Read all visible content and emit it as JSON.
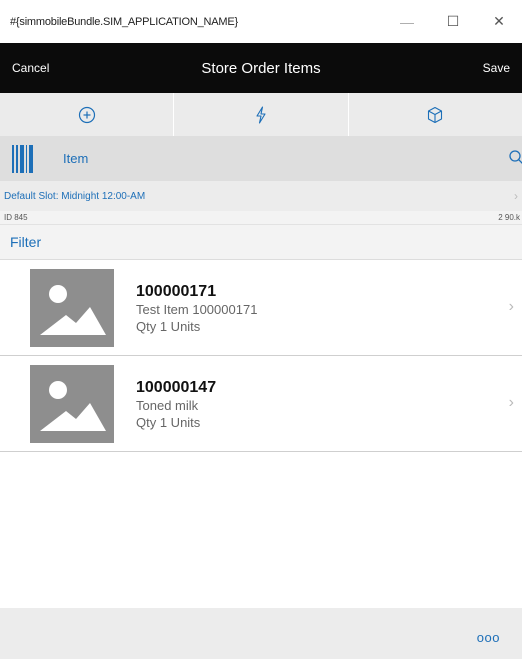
{
  "window": {
    "title": "#{simmobileBundle.SIM_APPLICATION_NAME}",
    "minimize_label": "—",
    "maximize_label": "☐",
    "close_label": "✕"
  },
  "header": {
    "cancel_label": "Cancel",
    "title": "Store Order Items",
    "save_label": "Save"
  },
  "tabs": [
    {
      "icon": "add-circle-icon"
    },
    {
      "icon": "lightning-icon"
    },
    {
      "icon": "package-icon"
    }
  ],
  "search": {
    "label": "Item"
  },
  "slot": {
    "text": "Default Slot: Midnight 12:00-AM",
    "chevron": "›"
  },
  "info": {
    "id_text": "ID 845",
    "right_text": "2 90.k"
  },
  "filter": {
    "label": "Filter"
  },
  "items": [
    {
      "id": "100000171",
      "description": "Test Item 100000171",
      "qty": "Qty 1 Units",
      "chevron": "›"
    },
    {
      "id": "100000147",
      "description": "Toned milk",
      "qty": "Qty 1 Units",
      "chevron": "›"
    }
  ],
  "footer": {
    "more_label": "ooo"
  },
  "colors": {
    "accent": "#1d6fb8",
    "header_bg": "#0b0b0b",
    "thumb_bg": "#8e8e8e"
  }
}
